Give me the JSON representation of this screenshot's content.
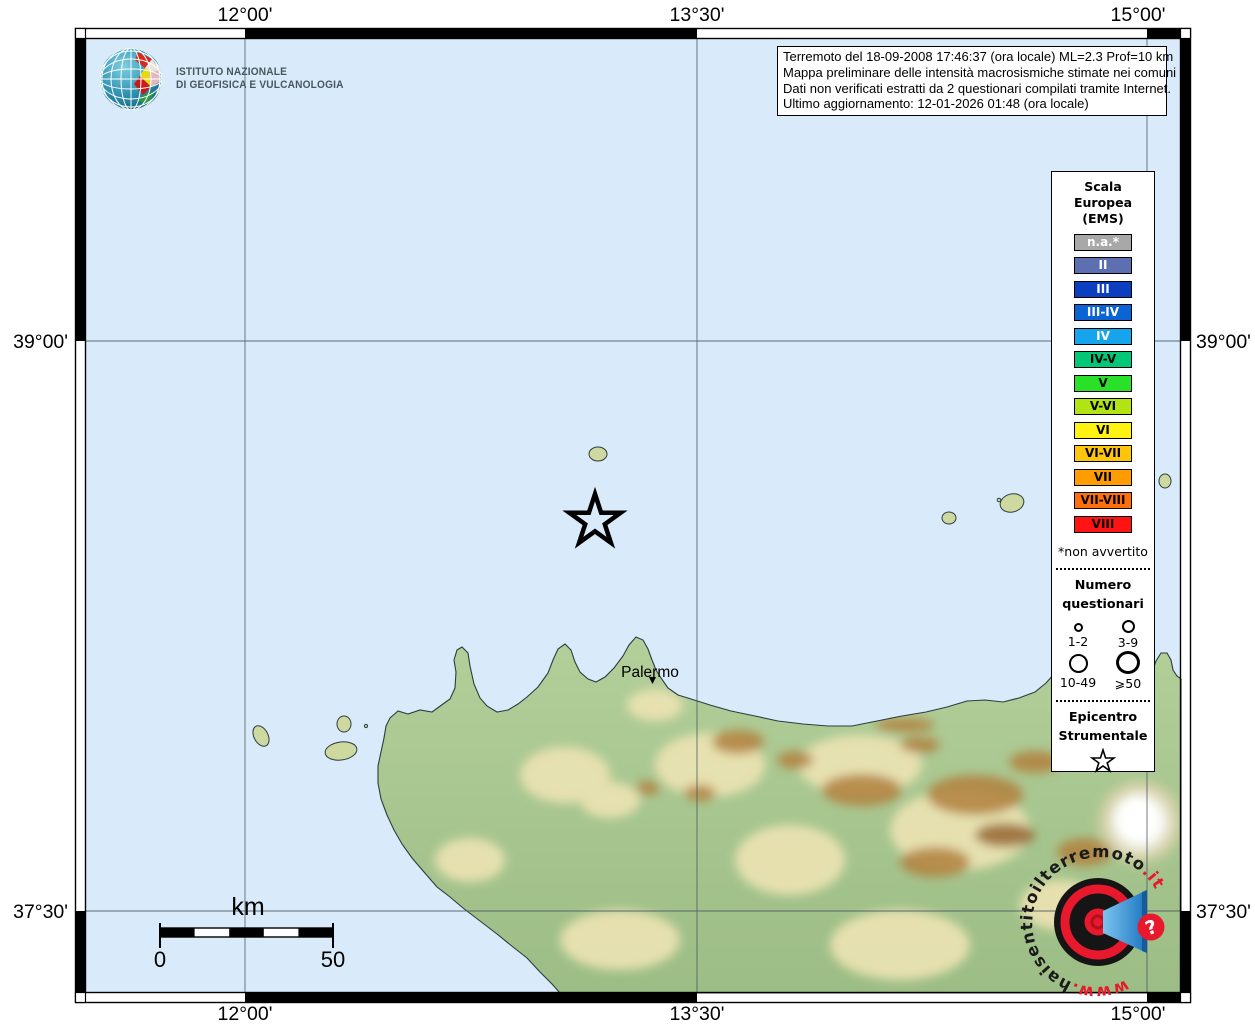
{
  "header": {
    "logo_line1": "ISTITUTO NAZIONALE",
    "logo_line2": "DI GEOFISICA E VULCANOLOGIA"
  },
  "info_box": {
    "line1": "Terremoto del 18-09-2008 17:46:37 (ora locale) ML=2.3 Prof=10 km",
    "line2": "Mappa preliminare delle intensità macrosismiche stimate nei comuni",
    "line3": "Dati non verificati estratti da 2 questionari compilati tramite Internet.",
    "line4": "Ultimo aggiornamento: 12-01-2026 01:48 (ora locale)"
  },
  "axes": {
    "top": [
      "12°00'",
      "13°30'",
      "15°00'"
    ],
    "bottom": [
      "12°00'",
      "13°30'",
      "15°00'"
    ],
    "left": [
      "39°00'",
      "37°30'"
    ],
    "right": [
      "39°00'",
      "37°30'"
    ]
  },
  "legend": {
    "title_line1": "Scala",
    "title_line2": "Europea",
    "title_line3": "(EMS)",
    "scale_items": [
      {
        "label": "n.a.*",
        "color": "#a8a8a8",
        "text": "#ffffff"
      },
      {
        "label": "II",
        "color": "#5c6fb0",
        "text": "#ffffff"
      },
      {
        "label": "III",
        "color": "#0b3fc0",
        "text": "#ffffff"
      },
      {
        "label": "III-IV",
        "color": "#0c63d4",
        "text": "#ffffff"
      },
      {
        "label": "IV",
        "color": "#16a4ec",
        "text": "#ffffff"
      },
      {
        "label": "IV-V",
        "color": "#00c878",
        "text": "#000000"
      },
      {
        "label": "V",
        "color": "#2ae12a",
        "text": "#000000"
      },
      {
        "label": "V-VI",
        "color": "#b2e414",
        "text": "#000000"
      },
      {
        "label": "VI",
        "color": "#fff212",
        "text": "#000000"
      },
      {
        "label": "VI-VII",
        "color": "#ffc40c",
        "text": "#000000"
      },
      {
        "label": "VII",
        "color": "#ff9c00",
        "text": "#000000"
      },
      {
        "label": "VII-VIII",
        "color": "#ff6e0d",
        "text": "#000000"
      },
      {
        "label": "VIII",
        "color": "#ff1414",
        "text": "#000000"
      }
    ],
    "footnote": "*non avvertito",
    "questionnaires": {
      "title_line1": "Numero",
      "title_line2": "questionari",
      "sizes": [
        {
          "label": "1-2"
        },
        {
          "label": "3-9"
        },
        {
          "label": "10-49"
        },
        {
          "label": "⩾50"
        }
      ]
    },
    "epicenter": {
      "title_line1": "Epicentro",
      "title_line2": "Strumentale"
    }
  },
  "scale_bar": {
    "unit": "km",
    "start": "0",
    "end": "50"
  },
  "map": {
    "city_label": "Palermo"
  },
  "watermark": {
    "prefix": "www.",
    "domain": "haisentitoilterremoto",
    "suffix": ".it",
    "question_mark": "?"
  },
  "colors": {
    "sea": "#d9eafa",
    "land_light": "#b3cf9a",
    "land_dark": "#9cbd85",
    "accent_red": "#e8192c",
    "accent_blue": "#39a0e0"
  }
}
